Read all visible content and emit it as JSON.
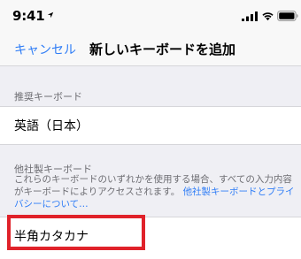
{
  "status_bar": {
    "time": "9:41",
    "icons": [
      "location-arrow-icon",
      "cellular-signal-icon",
      "wifi-icon",
      "battery-icon"
    ]
  },
  "nav": {
    "cancel_label": "キャンセル",
    "title": "新しいキーボードを追加"
  },
  "recommended": {
    "header": "推奨キーボード",
    "items": [
      {
        "label": "英語（日本）"
      }
    ]
  },
  "third_party": {
    "header": "他社製キーボード",
    "footer_text": "これらのキーボードのいずれかを使用する場合、すべての入力内容がキーボードによりアクセスされます。",
    "footer_link": "他社製キーボードとプライバシーについて…",
    "items": [
      {
        "label": "半角カタカナ"
      }
    ]
  },
  "colors": {
    "accent": "#2f7df6",
    "highlight": "#e0222a",
    "background": "#efeff4"
  }
}
